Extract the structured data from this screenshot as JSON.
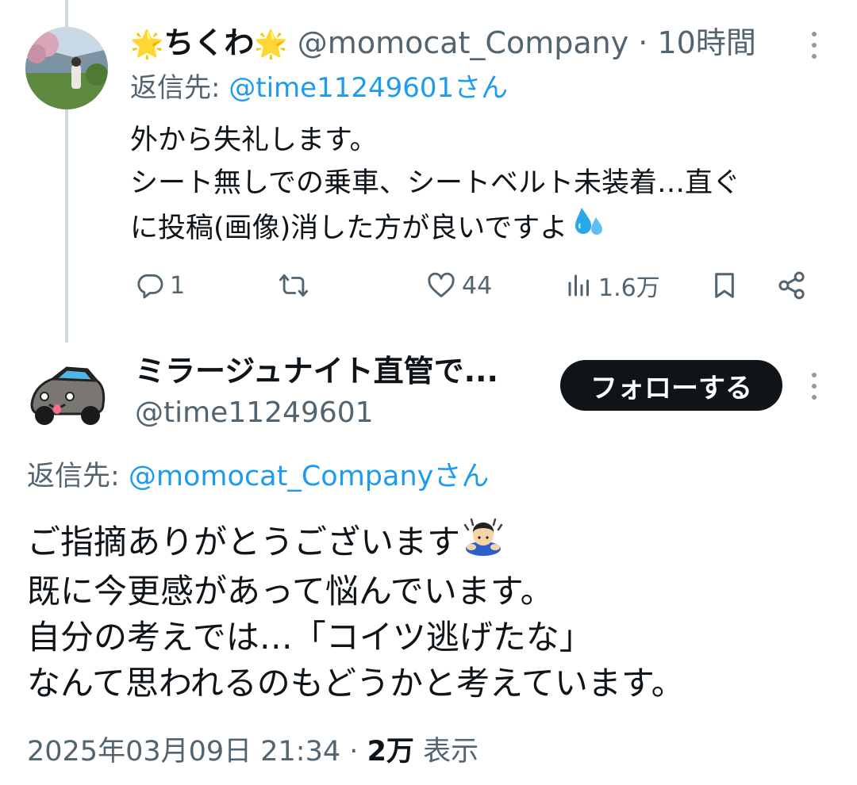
{
  "tweet1": {
    "display_name": "ちくわ",
    "handle": "@momocat_Company",
    "separator": "·",
    "time_ago": "10時間",
    "reply_prefix": "返信先: ",
    "reply_to": "@time11249601さん",
    "text_lines": [
      "外から失礼します。",
      "シート無しでの乗車、シートベルト未装着…直ぐ",
      "に投稿(画像)消した方が良いですよ"
    ],
    "reply_count": "1",
    "retweet_count": "",
    "like_count": "44",
    "view_count": "1.6万"
  },
  "tweet2": {
    "display_name": "ミラージュナイト直管で...",
    "handle": "@time11249601",
    "follow_label": "フォローする",
    "reply_prefix": "返信先: ",
    "reply_to": "@momocat_Companyさん",
    "text_lines": [
      "ご指摘ありがとうございます",
      "既に今更感があって悩んでいます。",
      "自分の考えでは…「コイツ逃げたな」",
      "なんて思われるのもどうかと考えています。"
    ],
    "timestamp": "2025年03月09日 21:34",
    "separator": "·",
    "views": "2万",
    "views_label": "表示"
  },
  "colors": {
    "accent": "#1d9bf0",
    "muted": "#536471",
    "text": "#0f1419",
    "thread_line": "#cfd9de"
  },
  "icons": [
    "sparkle-emoji",
    "sweat-droplets-emoji",
    "bowing-person-emoji",
    "reply-icon",
    "retweet-icon",
    "like-icon",
    "views-icon",
    "bookmark-icon",
    "share-icon",
    "more-icon"
  ]
}
